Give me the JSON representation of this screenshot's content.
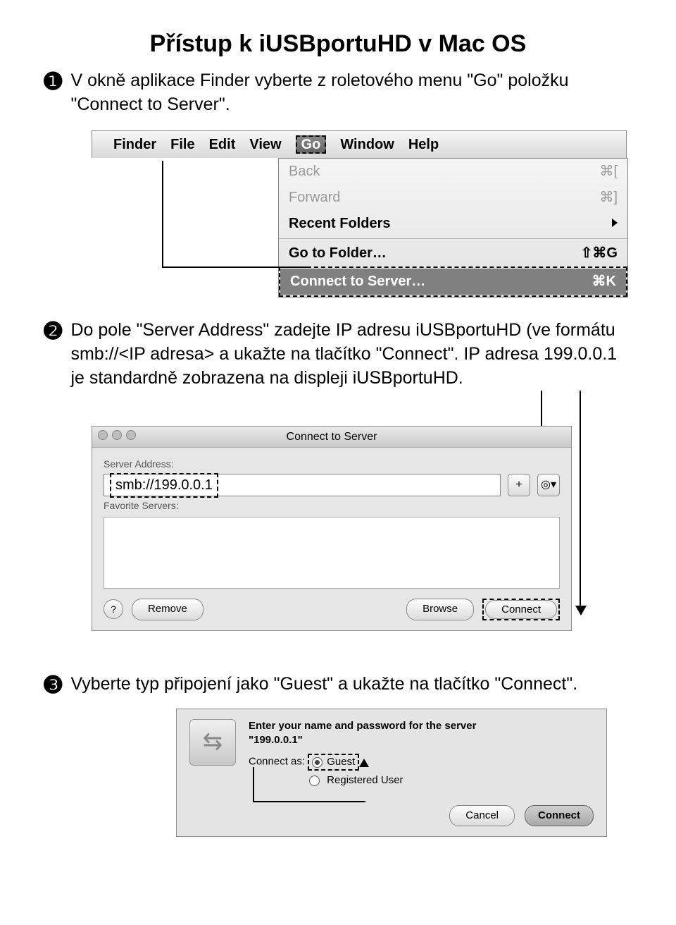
{
  "title": "Přístup k iUSBportuHD v Mac OS",
  "steps": {
    "s1": {
      "num": "❶",
      "text": "V okně aplikace Finder vyberte z roletového menu \"Go\" položku \"Connect to Server\"."
    },
    "s2": {
      "num": "❷",
      "text": "Do pole \"Server Address\" zadejte IP adresu iUSBportuHD (ve formátu smb://<IP adresa> a ukažte na tlačítko \"Connect\". IP adresa 199.0.0.1 je standardně zobrazena na displeji iUSBportuHD."
    },
    "s3": {
      "num": "❸",
      "text": "Vyberte typ připojení jako \"Guest\" a ukažte na tlačítko \"Connect\"."
    }
  },
  "menubar": {
    "finder": "Finder",
    "file": "File",
    "edit": "Edit",
    "view": "View",
    "go": "Go",
    "window": "Window",
    "help": "Help"
  },
  "go_menu": {
    "back": "Back",
    "back_sc": "⌘[",
    "forward": "Forward",
    "forward_sc": "⌘]",
    "recent": "Recent Folders",
    "goto": "Go to Folder…",
    "goto_sc": "⇧⌘G",
    "connect": "Connect to Server…",
    "connect_sc": "⌘K"
  },
  "connect_dialog": {
    "title": "Connect to Server",
    "server_address_label": "Server Address:",
    "address_value": "smb://199.0.0.1",
    "plus": "+",
    "history": "◎▾",
    "favorite_label": "Favorite Servers:",
    "help": "?",
    "remove": "Remove",
    "browse": "Browse",
    "connect": "Connect"
  },
  "auth_dialog": {
    "prompt1": "Enter your name and password for the server",
    "prompt2": "\"199.0.0.1\"",
    "connect_as": "Connect as:",
    "guest": "Guest",
    "registered": "Registered User",
    "cancel": "Cancel",
    "connect": "Connect"
  }
}
